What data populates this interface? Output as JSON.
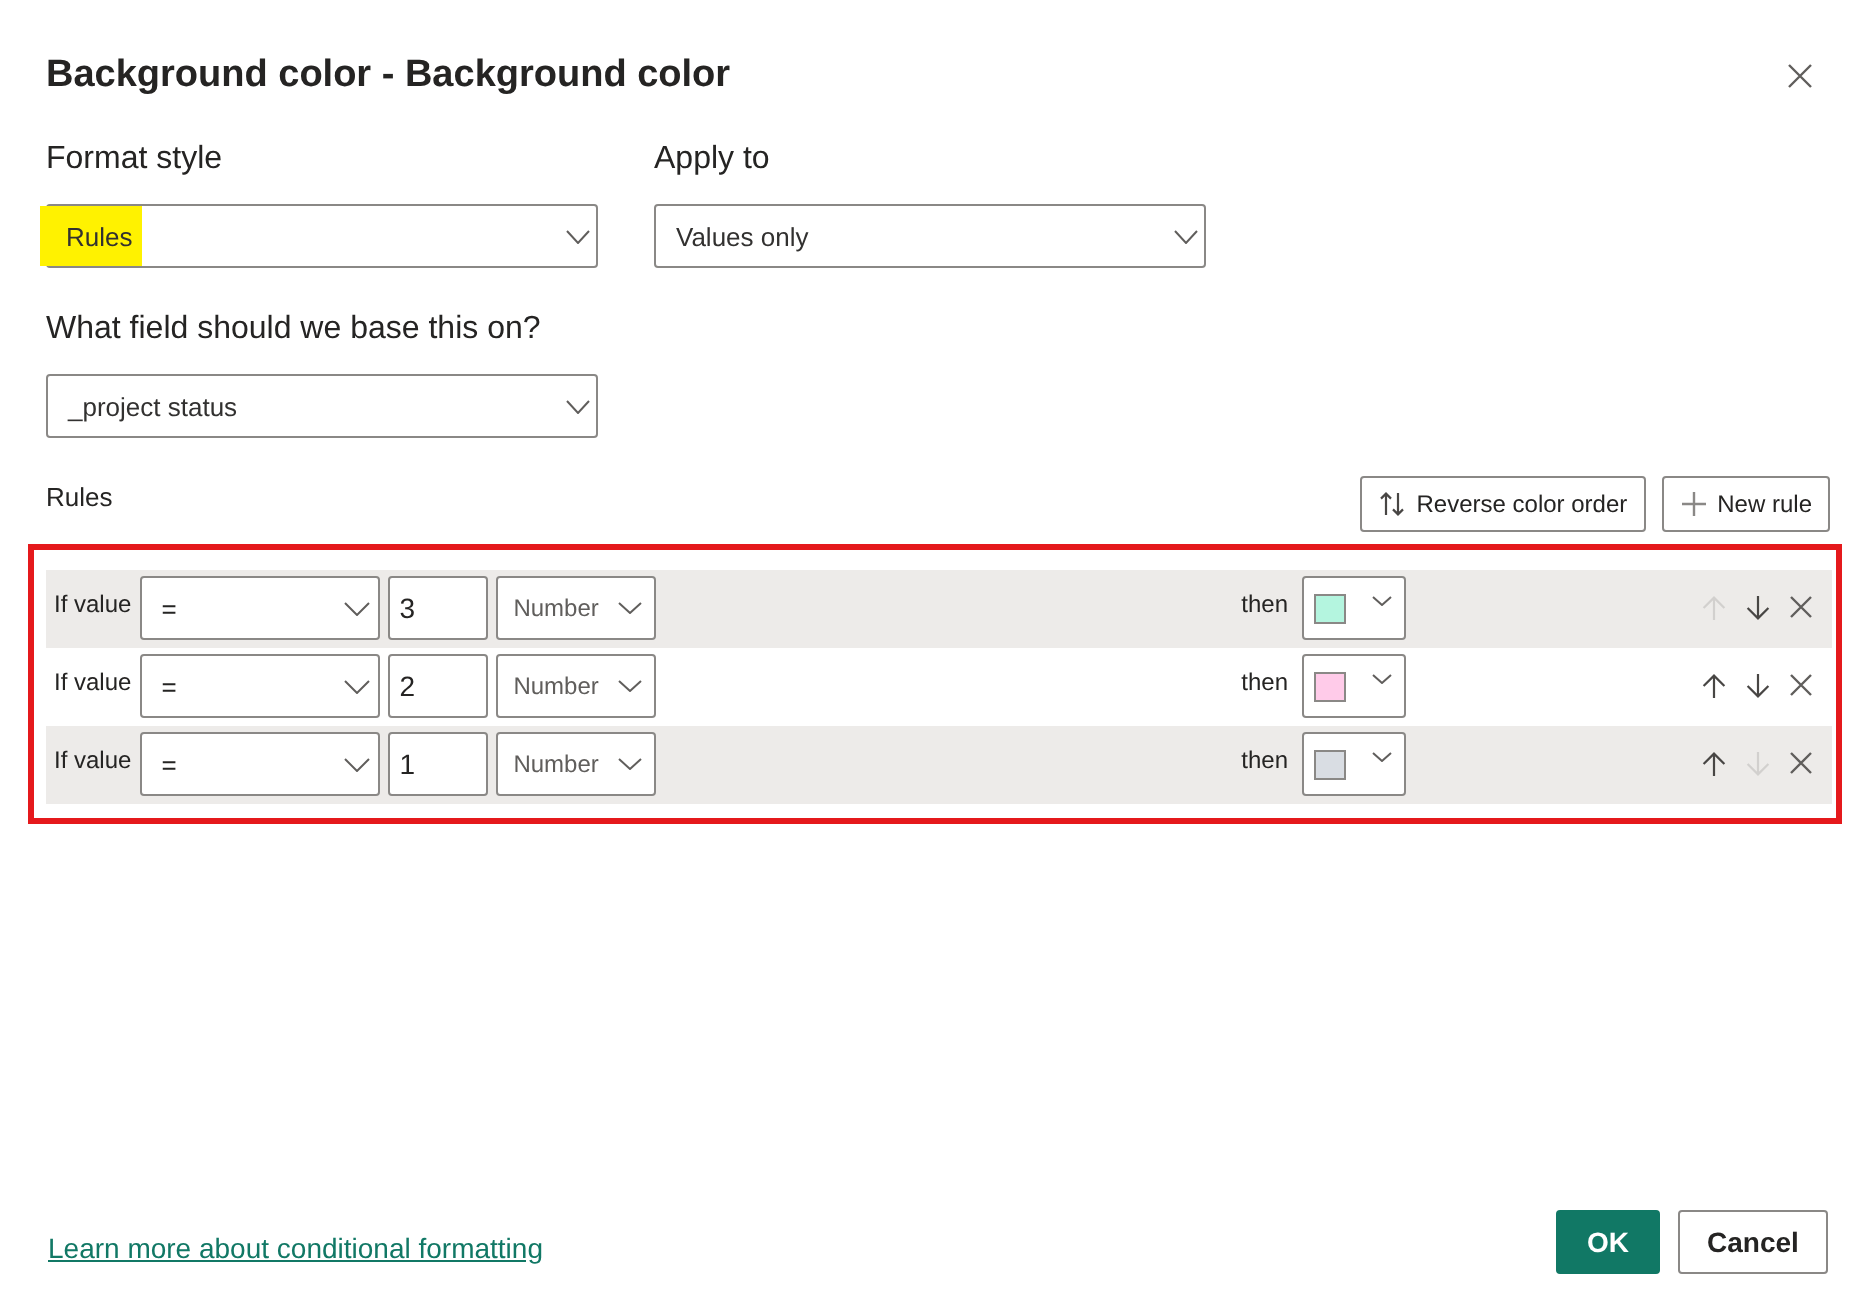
{
  "dialog": {
    "title": "Background color - Background color"
  },
  "fields": [
    {
      "label": "Format style",
      "value": "Rules",
      "highlighted": true
    },
    {
      "label": "Apply to",
      "value": "Values only",
      "highlighted": false
    },
    {
      "label": "What field should we base this on?",
      "value": "_project status",
      "highlighted": false
    }
  ],
  "rules": {
    "label": "Rules",
    "outlined": true,
    "buttons": [
      {
        "kind": "reverse",
        "label": "Reverse color order"
      },
      {
        "kind": "add",
        "label": "New rule"
      }
    ],
    "rows": [
      {
        "condition": "If value",
        "operator": "=",
        "value": "3",
        "unit": "Number",
        "then": "then",
        "color": "#b4f5df",
        "up_disabled": true,
        "down_disabled": false
      },
      {
        "condition": "If value",
        "operator": "=",
        "value": "2",
        "unit": "Number",
        "then": "then",
        "color": "#ffcbe9",
        "up_disabled": false,
        "down_disabled": false
      },
      {
        "condition": "If value",
        "operator": "=",
        "value": "1",
        "unit": "Number",
        "then": "then",
        "color": "#d9dde3",
        "up_disabled": false,
        "down_disabled": true
      }
    ]
  },
  "footer": {
    "link": "Learn more about conditional formatting",
    "buttons": [
      {
        "kind": "primary",
        "label": "OK"
      },
      {
        "kind": "secondary",
        "label": "Cancel"
      }
    ]
  }
}
